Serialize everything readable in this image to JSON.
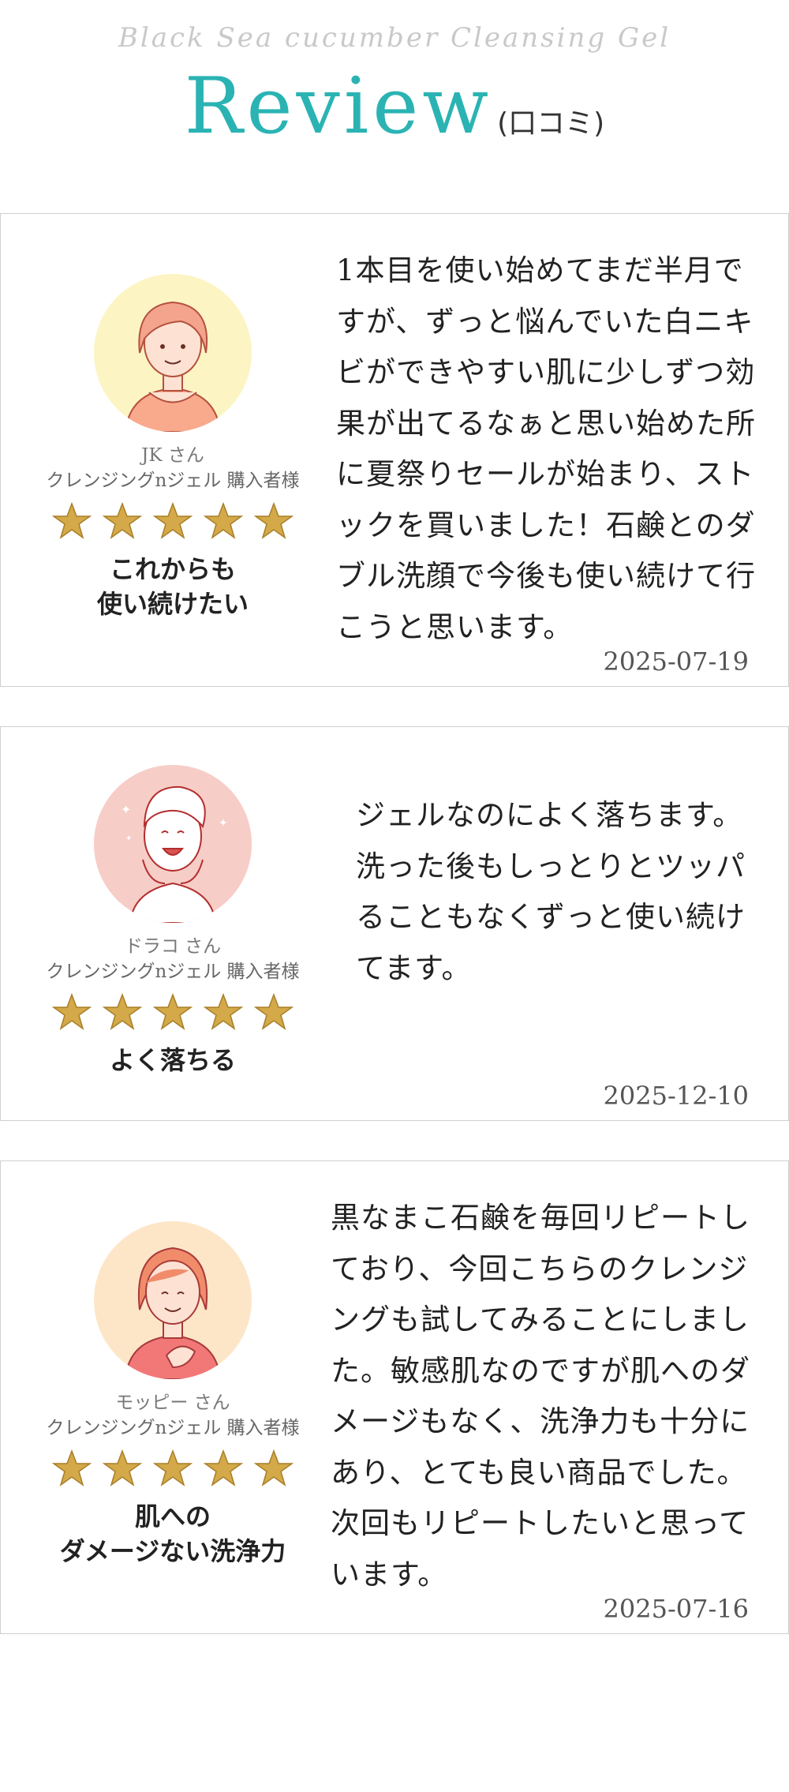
{
  "header": {
    "subtitle": "Black Sea cucumber Cleansing Gel",
    "title": "Review",
    "title_sub": "(口コミ)"
  },
  "reviews": [
    {
      "name": "JK さん",
      "product": "クレンジングnジェル  購入者様",
      "rating": 5,
      "headline_line1": "これからも",
      "headline_line2": "使い続けたい",
      "body": "1本目を使い始めてまだ半月ですが、ずっと悩んでいた白ニキビができやすい肌に少しずつ効果が出てるなぁと思い始めた所に夏祭りセールが始まり、ストックを買いました！石鹸とのダブル洗顔で今後も使い続けて行こうと思います。",
      "date": "2025-07-19",
      "avatar_icon": "woman-short-hair-avatar-icon",
      "avatar_bg": "#fdf4c4"
    },
    {
      "name": "ドラコ さん",
      "product": "クレンジングnジェル  購入者様",
      "rating": 5,
      "headline_line1": "よく落ちる",
      "headline_line2": "",
      "body": "ジェルなのによく落ちます。洗った後もしっとりとツッパることもなくずっと使い続けてます。",
      "date": "2025-12-10",
      "avatar_icon": "woman-towel-avatar-icon",
      "avatar_bg": "#f7cdc7"
    },
    {
      "name": "モッピー さん",
      "product": "クレンジングnジェル  購入者様",
      "rating": 5,
      "headline_line1": "肌への",
      "headline_line2": "ダメージない洗浄力",
      "body": "黒なまこ石鹸を毎回リピートしており、今回こちらのクレンジングも試してみることにしました。敏感肌なのですが肌へのダメージもなく、洗浄力も十分にあり、とても良い商品でした。次回もリピートしたいと思っています。",
      "date": "2025-07-16",
      "avatar_icon": "woman-hand-on-chest-avatar-icon",
      "avatar_bg": "#fde6c8"
    }
  ],
  "colors": {
    "accent": "#2bb3b3",
    "star": "#d4a94a",
    "border": "#cfcfcf"
  }
}
